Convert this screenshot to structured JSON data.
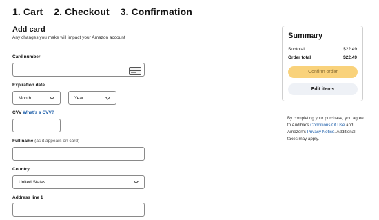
{
  "steps": [
    "1. Cart",
    "2. Checkout",
    "3. Confirmation"
  ],
  "form": {
    "title": "Add card",
    "subtitle": "Any changes you make will impact your Amazon account",
    "card_number": {
      "label": "Card number",
      "value": ""
    },
    "expiration": {
      "label": "Expiration date",
      "month": "Month",
      "year": "Year"
    },
    "cvv": {
      "label": "CVV",
      "help_link": "What's a CVV?",
      "value": ""
    },
    "full_name": {
      "label": "Full name",
      "hint": "(as it appears on card)",
      "value": ""
    },
    "country": {
      "label": "Country",
      "selected": "United States"
    },
    "address1": {
      "label": "Address line 1",
      "value": ""
    }
  },
  "summary": {
    "title": "Summary",
    "subtotal_label": "Subtotal",
    "subtotal_value": "$22.49",
    "total_label": "Order total",
    "total_value": "$22.49",
    "confirm_label": "Confirm order",
    "edit_label": "Edit items"
  },
  "legal": {
    "part1": "By completing your purchase, you agree to Audible's ",
    "link1": "Conditions Of Use",
    "part2": " and Amazon's ",
    "link2": "Privacy Notice",
    "part3": ". Additional taxes may apply."
  },
  "icons": {
    "card_field": "credit-card-icon",
    "dropdown": "chevron-down-icon"
  },
  "colors": {
    "confirm_bg": "#f9d27b",
    "link": "#1a5ca8",
    "edit_bg": "#eef1f6"
  }
}
